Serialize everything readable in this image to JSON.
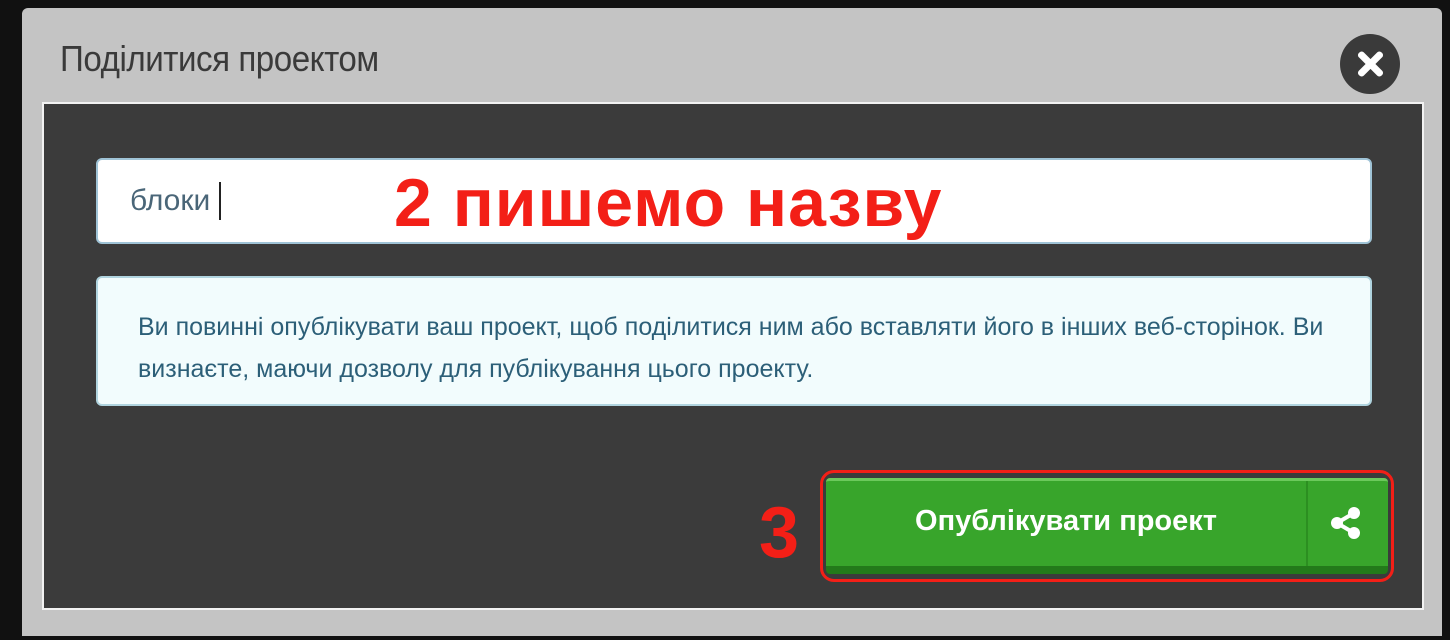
{
  "dialog": {
    "title": "Поділитися проектом"
  },
  "name_input": {
    "value": "блоки"
  },
  "annotations": {
    "step2": "2 пишемо назву",
    "step3": "3",
    "color": "#f31f17"
  },
  "info": {
    "text": "Ви повинні опублікувати ваш проект, щоб поділитися ним або вставляти його в інших веб-сторінок. Ви визнаєте, маючи дозволу для публікування цього проекту."
  },
  "publish_button": {
    "label": "Опублікувати проект",
    "icon": "share-icon",
    "color": "#38a52b"
  },
  "close_icon": "close-icon"
}
